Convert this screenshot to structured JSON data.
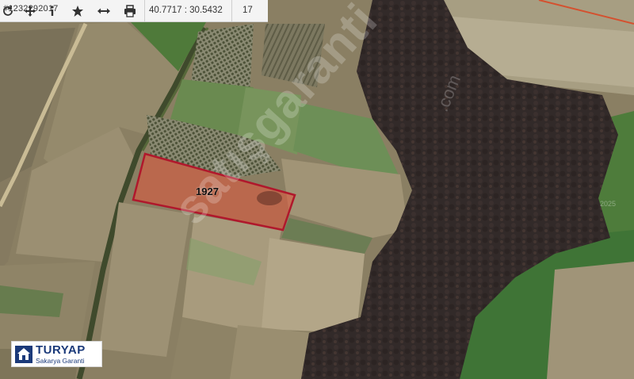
{
  "toolbar": {
    "listing_no": "#1232292017",
    "coordinates": "40.7717 : 30.5432",
    "zoom": "17",
    "icons": [
      "refresh-icon",
      "move-icon",
      "info-icon",
      "star-icon",
      "resize-icon",
      "print-icon"
    ]
  },
  "parcel": {
    "label": "1927",
    "border_color": "#b0182c",
    "fill_color": "#e2563d"
  },
  "watermark": {
    "text": "satışgaranti",
    "small_text": ".com"
  },
  "imagery_year": "2025",
  "logo": {
    "title": "TURYAP",
    "subtitle": "Sakarya Garanti"
  }
}
